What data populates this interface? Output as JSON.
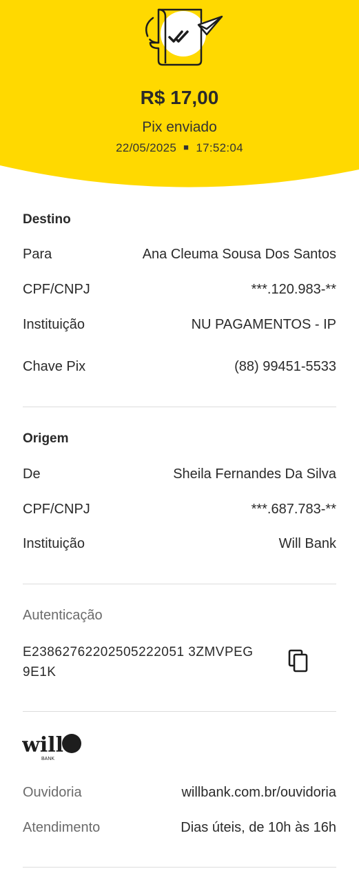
{
  "header": {
    "amount": "R$ 17,00",
    "status": "Pix enviado",
    "date": "22/05/2025",
    "time": "17:52:04",
    "background_color": "#FFD900",
    "icon": "receipt-check-paper-plane-icon"
  },
  "destino": {
    "title": "Destino",
    "rows": [
      {
        "label": "Para",
        "value": "Ana Cleuma Sousa Dos Santos"
      },
      {
        "label": "CPF/CNPJ",
        "value": "***.120.983-**"
      },
      {
        "label": "Instituição",
        "value": "NU PAGAMENTOS - IP"
      },
      {
        "label": "Chave Pix",
        "value": "(88) 99451-5533"
      }
    ]
  },
  "origem": {
    "title": "Origem",
    "rows": [
      {
        "label": "De",
        "value": "Sheila Fernandes Da Silva"
      },
      {
        "label": "CPF/CNPJ",
        "value": "***.687.783-**"
      },
      {
        "label": "Instituição",
        "value": "Will Bank"
      }
    ]
  },
  "autenticacao": {
    "label": "Autenticação",
    "code": "E23862762202505222051 3ZMVPEG9E1K",
    "copy_icon": "copy-icon"
  },
  "footer": {
    "logo_text": "will",
    "logo_sub": "BANK",
    "rows": [
      {
        "label": "Ouvidoria",
        "value": "willbank.com.br/ouvidoria"
      },
      {
        "label": "Atendimento",
        "value": "Dias úteis, de 10h às 16h"
      }
    ]
  }
}
